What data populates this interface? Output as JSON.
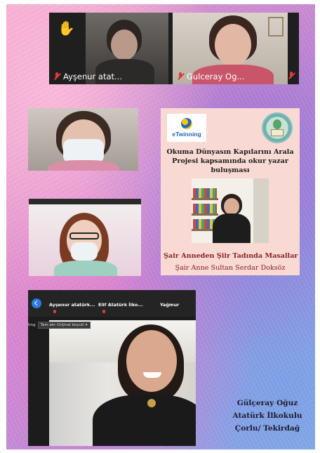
{
  "meeting": {
    "participant_1": {
      "name": "Ayşenur atat..."
    },
    "participant_2": {
      "name": "Gulceray Og..."
    }
  },
  "card": {
    "logo_text": "eTwinning",
    "title_lines": [
      "Okuma Dünyasın Kapılarını Arala",
      "Projesi kapsamında okur yazar",
      "buluşması"
    ],
    "subtitle": "Şair Anneden Şiir Tadında Masallar",
    "author": "Şair Anne Sultan Serdar Doksöz"
  },
  "zoom": {
    "participants": [
      "Ayşenur atatürk...",
      "Elif Atatürk İlko...",
      "Yağmur"
    ],
    "sub_label": "ting",
    "select_value": "Tam ekr Orijinal boyutl"
  },
  "signature": {
    "lines": [
      "Gülçeray Oğuz",
      "Atatürk İlkokulu",
      "Çorlu/ Tekirdağ"
    ]
  },
  "colors": {
    "card_bg": "#f9d9d3",
    "subtitle_red": "#8a2222",
    "muted_mic": "#e03b3b",
    "hand": "#f4c542",
    "back_button": "#2d7be0"
  },
  "icons": [
    "raised-hand-icon",
    "mic-off-icon",
    "back-arrow-icon",
    "chevron-down-icon",
    "etwinning-logo",
    "project-badge"
  ]
}
